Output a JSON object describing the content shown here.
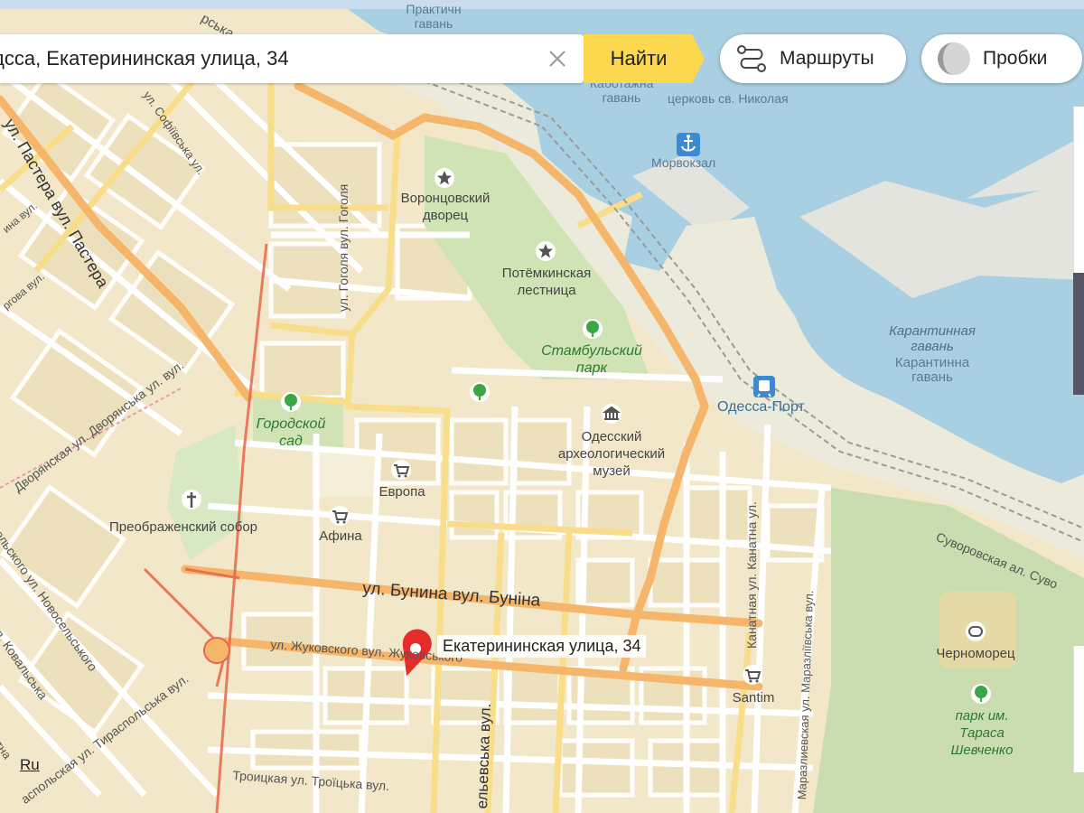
{
  "search": {
    "value": "дсса, Екатерининская улица, 34",
    "find_label": "Найти",
    "accent_color": "#fcd84f"
  },
  "controls": {
    "routes_label": "Маршруты",
    "traffic_label": "Пробки"
  },
  "language_link": "Ru",
  "pin": {
    "label": "Екатерининская улица, 34",
    "color": "#e62b2b"
  },
  "streets": {
    "pastera": "ул. Пастера вул. Пастера",
    "sofiivska": "ул. Софіївська ул.",
    "gogolya": "ул. Гоголя вул. Гоголя",
    "dvoryanskaya": "Дворянская ул. Дворянська ул. вул.",
    "bunina": "ул. Бунина вул. Буніна",
    "zhukovskogo": "ул. Жуковского вул. Жуковського",
    "kanatnaya": "Канатная ул. Канатна ул.",
    "marazlievskaya": "Маразлиевская ул. Маразліївська вул.",
    "suvorovskaya": "Суворовская ал. Суво",
    "troitskaya": "Троицкая ул. Троїцька вул.",
    "novoselskogo": "сельского ул. Новосельського",
    "kovalskaya": "ул. Ковальська",
    "tiraspolskaya": "аспольская ул. Тираспольська вул.",
    "ekaterininskaya_vert": "ельевська вул.",
    "left_edge": "ина вул.",
    "left_edge2": "ргова вул.",
    "top_label": "рська",
    "bottom_left": "ятна"
  },
  "places": {
    "kabotazhnaya": "Каботажна гавань",
    "top_harbour": "Практичн гавань",
    "nikolay_church": "церковь св. Николая",
    "morvokzal": "Морвокзал",
    "vorontsov_1": "Воронцовский",
    "vorontsov_2": "дворец",
    "potemkin_1": "Потёмкинская",
    "potemkin_2": "лестница",
    "istanbul_1": "Стамбульский",
    "istanbul_2": "парк",
    "gorodskoy_1": "Городской",
    "gorodskoy_2": "сад",
    "archeo_1": "Одесский",
    "archeo_2": "археологический",
    "archeo_3": "музей",
    "odessa_port": "Одесса-Порт",
    "karantin_it_1": "Карантинная",
    "karantin_it_2": "гавань",
    "karantin_1": "Карантинна",
    "karantin_2": "гавань",
    "evropa": "Европа",
    "afina": "Афина",
    "preobrazhensky": "Преображенский собор",
    "chernomorets": "Черноморец",
    "santim": "Santim",
    "shevchenko_1": "парк им.",
    "shevchenko_2": "Тараса",
    "shevchenko_3": "Шевченко"
  },
  "colors": {
    "land": "#f2e8c9",
    "block": "#ece0bc",
    "water": "#a9cfe3",
    "park": "#cfe3b5",
    "port": "#e3e4de",
    "major_road": "#f5b66b",
    "secondary_road": "#f8dd8a",
    "red_road": "#e8664a"
  }
}
